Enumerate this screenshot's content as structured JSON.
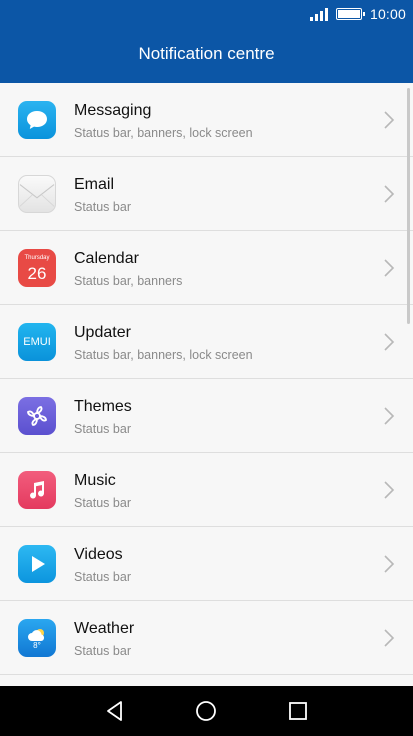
{
  "status_bar": {
    "time": "10:00"
  },
  "header": {
    "title": "Notification centre"
  },
  "apps": [
    {
      "name": "Messaging",
      "detail": "Status bar, banners, lock screen"
    },
    {
      "name": "Email",
      "detail": "Status bar"
    },
    {
      "name": "Calendar",
      "detail": "Status bar, banners",
      "icon_day_name": "Thursday",
      "icon_day_number": "26"
    },
    {
      "name": "Updater",
      "detail": "Status bar, banners, lock screen",
      "icon_text": "EMUI"
    },
    {
      "name": "Themes",
      "detail": "Status bar"
    },
    {
      "name": "Music",
      "detail": "Status bar"
    },
    {
      "name": "Videos",
      "detail": "Status bar"
    },
    {
      "name": "Weather",
      "detail": "Status bar",
      "icon_temp": "8°"
    }
  ],
  "colors": {
    "header": "#0c56a6",
    "background": "#f7f7f7",
    "nav_bar": "#000000"
  }
}
